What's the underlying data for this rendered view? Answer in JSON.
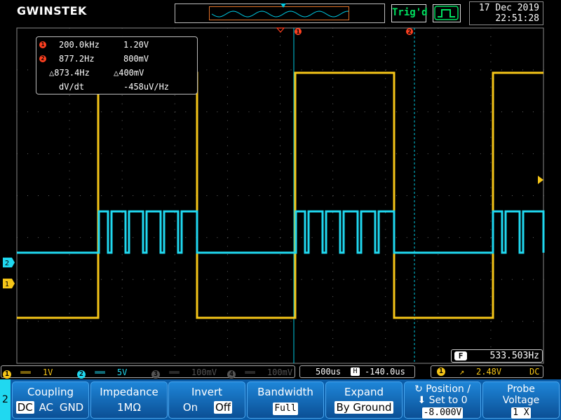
{
  "header": {
    "logo": "GWINSTEK",
    "trigger_status": "Trig'd",
    "date": "17 Dec 2019",
    "time": "22:51:28"
  },
  "cursor_readout": {
    "cursor1": {
      "badge": "1",
      "freq": "200.0kHz",
      "volt": "1.20V"
    },
    "cursor2": {
      "badge": "2",
      "freq": "877.2Hz",
      "volt": "800mV"
    },
    "delta": {
      "freq": "△873.4Hz",
      "volt": "△400mV"
    },
    "slope": {
      "label": "dV/dt",
      "value": "-458uV/Hz"
    }
  },
  "cursor_markers": {
    "c1": "1",
    "c2": "2"
  },
  "channel_markers": {
    "ch1": "1",
    "ch2": "2"
  },
  "frequency_counter": {
    "icon": "F",
    "value": "533.503Hz"
  },
  "status": {
    "ch1": {
      "badge": "1",
      "coupling": "══",
      "scale": "1V"
    },
    "ch2": {
      "badge": "2",
      "coupling": "══",
      "scale": "5V"
    },
    "ch3": {
      "badge": "3",
      "coupling": "══",
      "scale": "100mV"
    },
    "ch4": {
      "badge": "4",
      "coupling": "══",
      "scale": "100mV"
    },
    "timebase": "500us",
    "horizontal_icon": "H",
    "offset": "-140.0us",
    "trigger_source": "1",
    "trigger_slope": "↗",
    "trigger_level": "2.48V",
    "trigger_coupling": "DC"
  },
  "menu": {
    "channel": "2",
    "coupling": {
      "title": "Coupling",
      "options": [
        "DC",
        "AC",
        "GND"
      ]
    },
    "impedance": {
      "title": "Impedance",
      "value": "1MΩ"
    },
    "invert": {
      "title": "Invert",
      "on": "On",
      "off": "Off"
    },
    "bandwidth": {
      "title": "Bandwidth",
      "value": "Full"
    },
    "expand": {
      "title": "Expand",
      "value": "By Ground"
    },
    "position": {
      "title": "↻ Position /",
      "sub": "⬇ Set to 0",
      "value": "-8.000V"
    },
    "probe": {
      "title": "Probe",
      "title2": "Voltage",
      "value": "1 X"
    }
  },
  "colors": {
    "ch1": "#f5c518",
    "ch2": "#20d8f0",
    "cursor": "#ff4020",
    "grid": "#5a5a5a",
    "menu": "#0a5ca8"
  }
}
